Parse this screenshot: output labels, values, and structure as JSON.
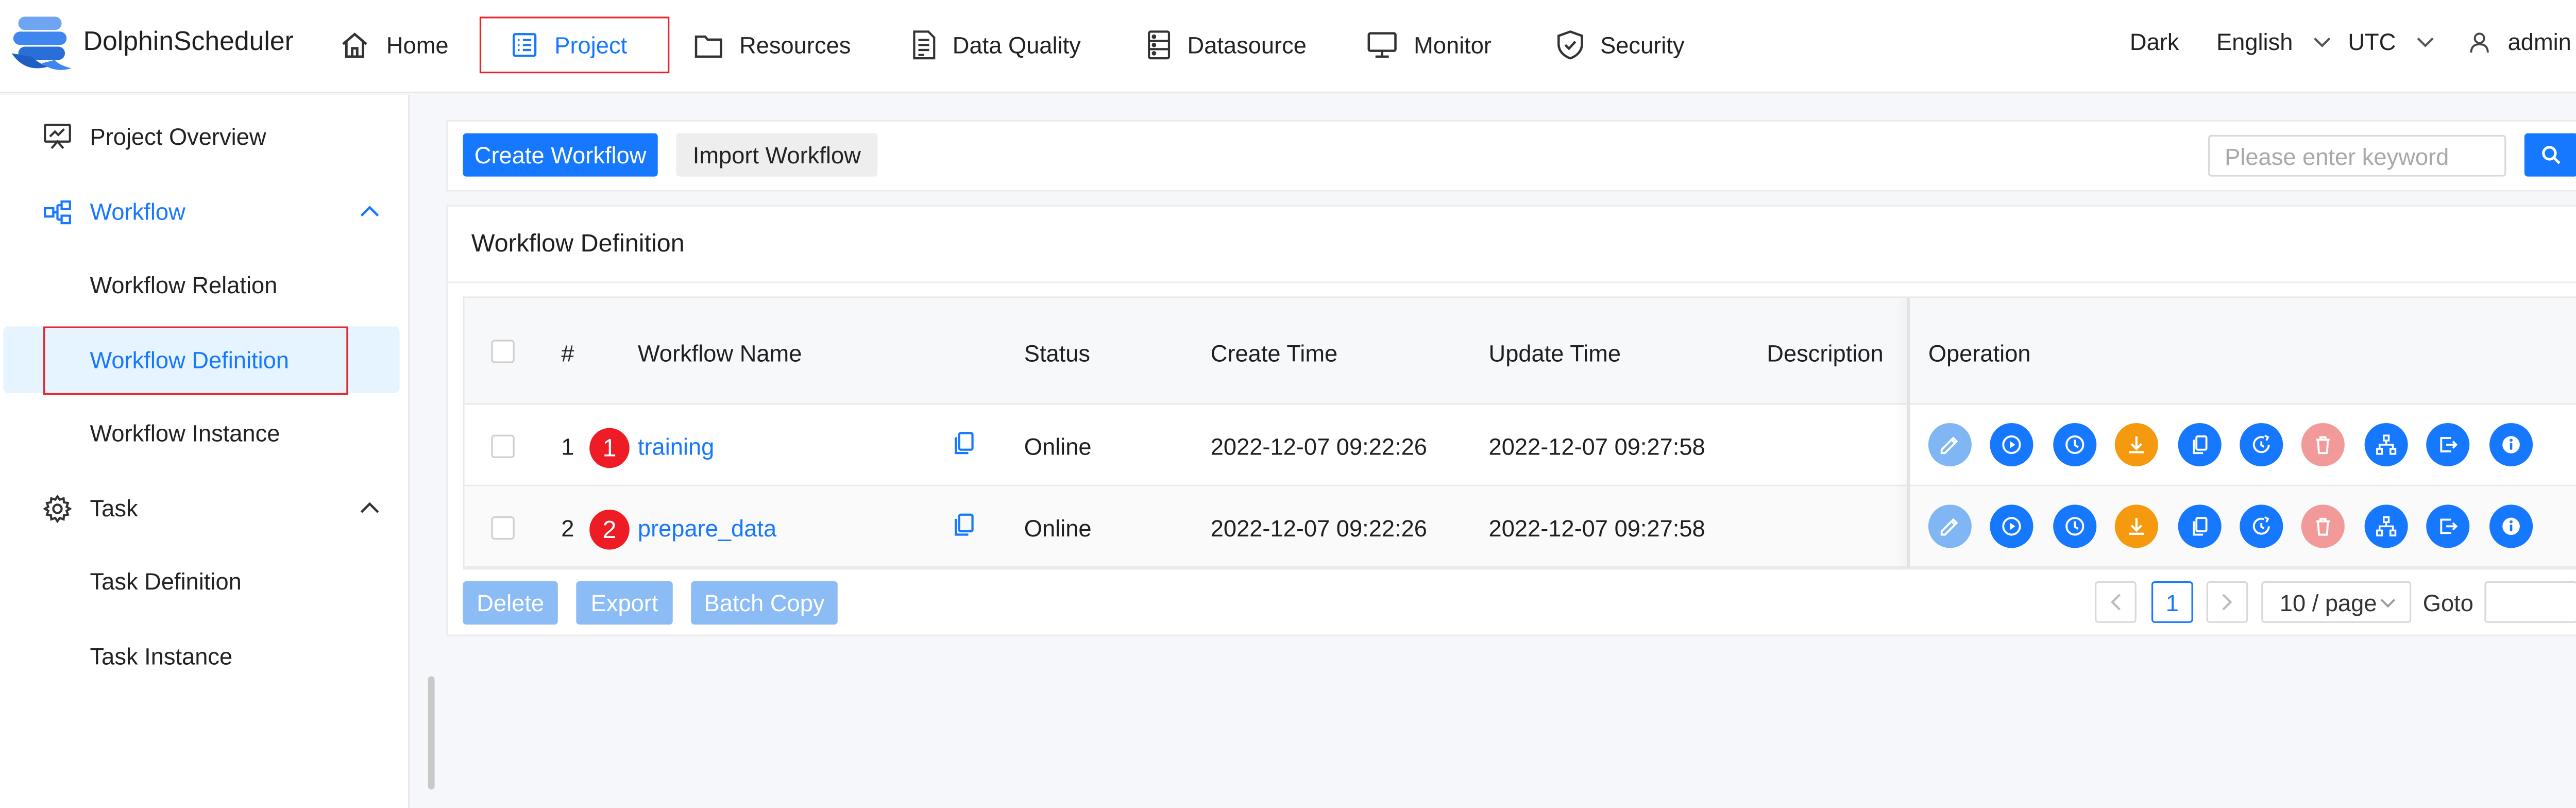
{
  "app": {
    "name": "DolphinScheduler"
  },
  "nav": [
    {
      "label": "Home",
      "icon": "home-icon"
    },
    {
      "label": "Project",
      "icon": "project-icon",
      "active": true
    },
    {
      "label": "Resources",
      "icon": "folder-icon"
    },
    {
      "label": "Data Quality",
      "icon": "data-quality-icon"
    },
    {
      "label": "Datasource",
      "icon": "database-icon"
    },
    {
      "label": "Monitor",
      "icon": "monitor-icon"
    },
    {
      "label": "Security",
      "icon": "shield-icon"
    }
  ],
  "header_right": {
    "theme": "Dark",
    "language": "English",
    "timezone": "UTC",
    "user": "admin"
  },
  "sidebar": {
    "items": [
      {
        "label": "Project Overview",
        "icon": "presentation-chart-icon"
      },
      {
        "label": "Workflow",
        "icon": "workflow-icon",
        "expanded": true
      },
      {
        "label": "Workflow Relation"
      },
      {
        "label": "Workflow Definition",
        "selected": true
      },
      {
        "label": "Workflow Instance"
      },
      {
        "label": "Task",
        "icon": "gear-icon",
        "expanded": true
      },
      {
        "label": "Task Definition"
      },
      {
        "label": "Task Instance"
      }
    ]
  },
  "toolbar": {
    "create_label": "Create Workflow",
    "import_label": "Import Workflow",
    "search_placeholder": "Please enter keyword"
  },
  "section": {
    "title": "Workflow Definition"
  },
  "table": {
    "columns": [
      "#",
      "Workflow Name",
      "Status",
      "Create Time",
      "Update Time",
      "Description",
      "Operation"
    ],
    "rows": [
      {
        "index": "1",
        "badge": "1",
        "name": "training",
        "status": "Online",
        "create_time": "2022-12-07 09:22:26",
        "update_time": "2022-12-07 09:27:58",
        "description": ""
      },
      {
        "index": "2",
        "badge": "2",
        "name": "prepare_data",
        "status": "Online",
        "create_time": "2022-12-07 09:22:26",
        "update_time": "2022-12-07 09:27:58",
        "description": ""
      }
    ],
    "operations": [
      {
        "icon": "edit-icon",
        "color": "#7fb6f3"
      },
      {
        "icon": "play-circle-icon",
        "color": "#1677ff"
      },
      {
        "icon": "clock-icon",
        "color": "#1677ff"
      },
      {
        "icon": "download-icon",
        "color": "#f59a0e"
      },
      {
        "icon": "copy-icon",
        "color": "#1677ff"
      },
      {
        "icon": "timer-icon",
        "color": "#1677ff"
      },
      {
        "icon": "trash-icon",
        "color": "#f29a9a"
      },
      {
        "icon": "tree-icon",
        "color": "#1677ff"
      },
      {
        "icon": "export-icon",
        "color": "#1677ff"
      },
      {
        "icon": "info-icon",
        "color": "#1677ff"
      }
    ]
  },
  "bulk_actions": {
    "delete_label": "Delete",
    "export_label": "Export",
    "batch_copy_label": "Batch Copy"
  },
  "pagination": {
    "current_page": "1",
    "page_size": "10 / page",
    "goto_label": "Goto"
  },
  "colors": {
    "accent": "#1677ff",
    "highlight_box": "#e5262b",
    "badge": "#ee1c24",
    "warning": "#f59a0e"
  }
}
